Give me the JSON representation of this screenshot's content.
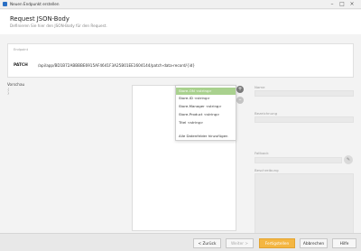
{
  "window": {
    "title": "Neuen Endpunkt erstellen",
    "minimize": "–",
    "maximize": "□",
    "close": "×"
  },
  "header": {
    "title": "Request JSON-Body",
    "subtitle": "Definieren Sie hier den JSON-Body für den Request."
  },
  "endpoint": {
    "label": "Endpoint",
    "method": "PATCH",
    "url": "/api/app/BD1B72ABBBBE6915AF4641F3A25B01EE1604144/patch-data-record/{id}"
  },
  "preview": {
    "label": "Vorschau",
    "code": [
      "{",
      "}"
    ]
  },
  "tree_buttons": {
    "add": "+",
    "remove": "–"
  },
  "dropdown": {
    "items": [
      "Store-ON <string>",
      "Store-ID <string>",
      "Store-Manager <string>",
      "Store-Product <string>",
      "Titel <string>",
      "",
      "Alle Datenfelder hinzufügen"
    ],
    "selected_index": 0
  },
  "properties": {
    "name_label": "Name",
    "description_label": "Bezeichnung",
    "fallback_label": "Fallback",
    "notes_label": "Beschreibung",
    "edit_icon": "✎"
  },
  "footer": {
    "back": "< Zurück",
    "next": "Weiter >",
    "finish": "Fertigstellen",
    "cancel": "Abbrechen",
    "help": "Hilfe"
  },
  "colors": {
    "selected": "#a9d18e",
    "primary": "#f4b642"
  }
}
